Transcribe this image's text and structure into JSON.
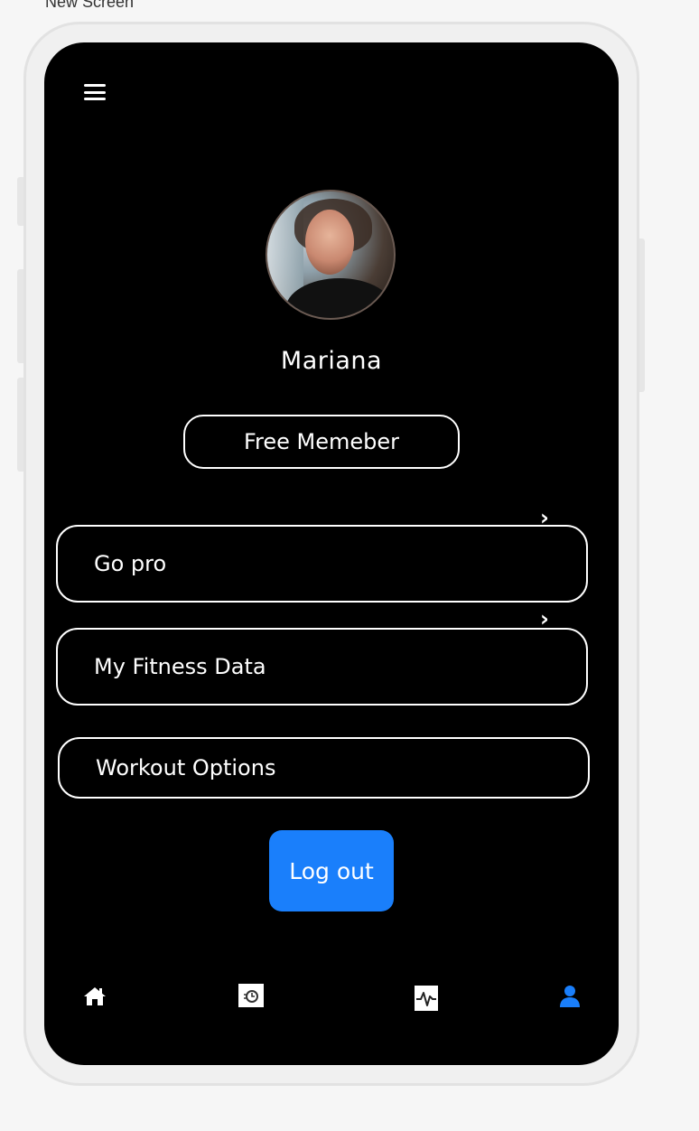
{
  "screen_label": "New Screen",
  "profile": {
    "name": "Mariana",
    "membership": "Free Memeber"
  },
  "options": [
    {
      "label": "Go pro"
    },
    {
      "label": "My Fitness Data"
    },
    {
      "label": "Workout Options"
    }
  ],
  "logout_label": "Log out",
  "colors": {
    "accent": "#1a7ffb",
    "screen_bg": "#000000",
    "active_nav": "#1a7ffb"
  },
  "bottom_nav": [
    {
      "icon": "home-icon"
    },
    {
      "icon": "timer-icon"
    },
    {
      "icon": "activity-icon"
    },
    {
      "icon": "profile-icon",
      "active": true
    }
  ]
}
